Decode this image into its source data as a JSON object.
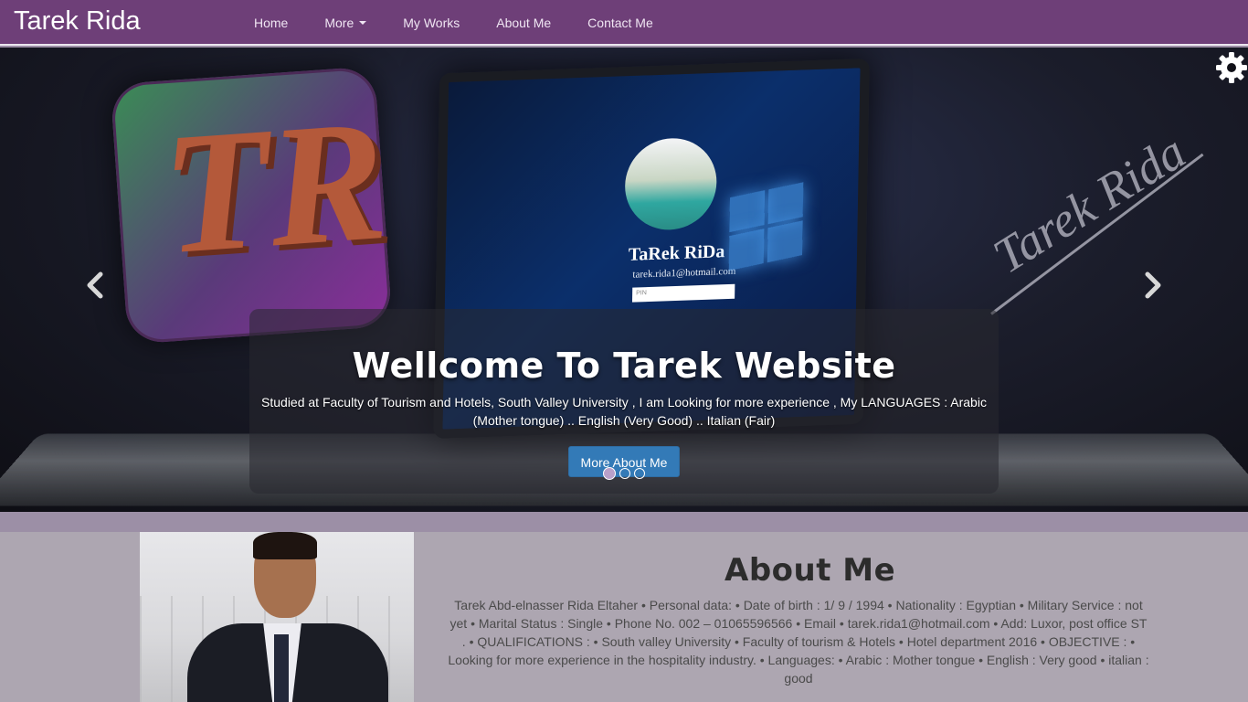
{
  "nav": {
    "brand": "Tarek Rida",
    "items": [
      {
        "label": "Home"
      },
      {
        "label": "More",
        "has_dropdown": true
      },
      {
        "label": "My Works"
      },
      {
        "label": "About Me"
      },
      {
        "label": "Contact Me"
      }
    ]
  },
  "carousel": {
    "screen_name": "TaRek RiDa",
    "screen_email": "tarek.rida1@hotmail.com",
    "screen_pin_placeholder": "PIN",
    "logo_letters": "TR",
    "signature": "Tarek Rida",
    "caption_title": "Wellcome To Tarek Website",
    "caption_text": "Studied at Faculty of Tourism and Hotels, South Valley University , I am Looking for more experience , My LANGUAGES : Arabic (Mother tongue) .. English (Very Good) .. Italian (Fair)",
    "button_label": "More About Me",
    "indicators": 3,
    "active_indicator": 0,
    "icons": {
      "prev": "chevron-left-icon",
      "next": "chevron-right-icon",
      "settings": "gear-icon"
    }
  },
  "about": {
    "title": "About Me",
    "text": "Tarek Abd-elnasser Rida Eltaher • Personal data: • Date of birth : 1/ 9 / 1994 • Nationality : Egyptian • Military Service : not yet • Marital Status : Single • Phone No. 002 – 01065596566 • Email • tarek.rida1@hotmail.com • Add: Luxor, post office ST . • QUALIFICATIONS : • South valley University • Faculty of tourism & Hotels • Hotel department 2016 • OBJECTIVE : • Looking for more experience in the hospitality industry. • Languages: • Arabic : Mother tongue • English : Very good • italian : good"
  },
  "colors": {
    "navbar": "#6e3f78",
    "page_bg": "#9c8fa6",
    "about_bg": "#ada6b1",
    "primary_button": "#337ab7"
  }
}
